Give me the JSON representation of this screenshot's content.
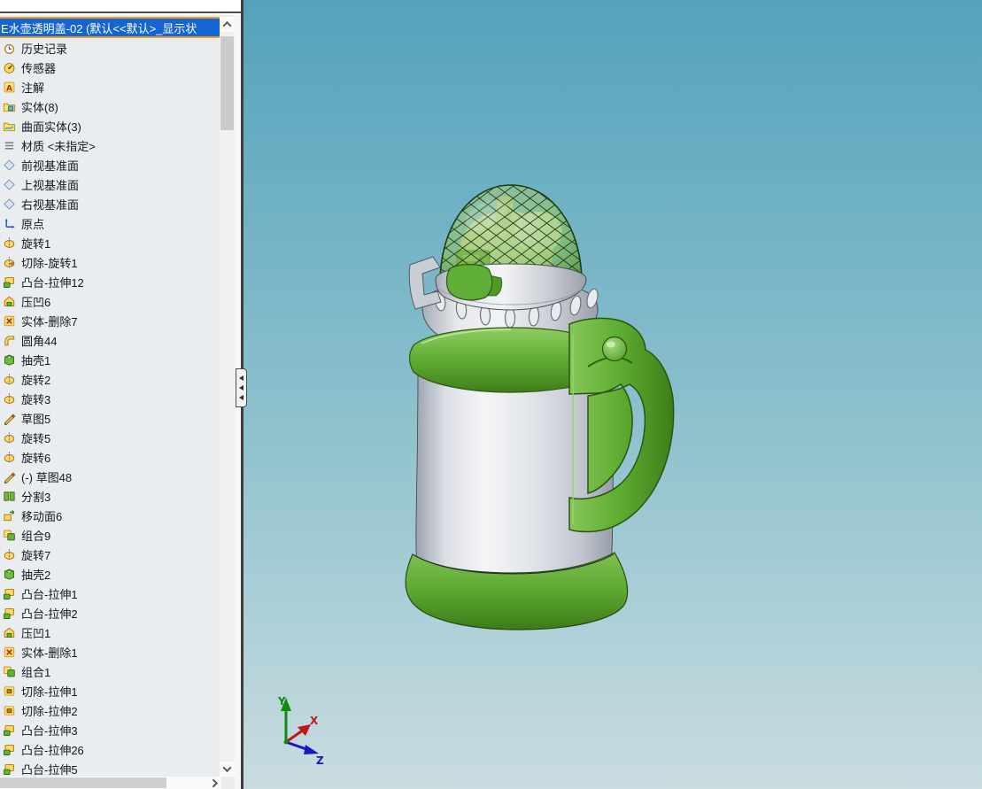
{
  "feature_tree": {
    "root": {
      "label": "E水壶透明盖-02  (默认<<默认>_显示状",
      "highlight_color": "#1464D2",
      "highlight_border": "#E8A01E"
    },
    "items": [
      {
        "label": "历史记录",
        "icon": "history"
      },
      {
        "label": "传感器",
        "icon": "sensor"
      },
      {
        "label": "注解",
        "icon": "annotation"
      },
      {
        "label": "实体(8)",
        "icon": "solid-folder"
      },
      {
        "label": "曲面实体(3)",
        "icon": "surface-folder"
      },
      {
        "label": "材质 <未指定>",
        "icon": "material"
      },
      {
        "label": "前视基准面",
        "icon": "plane"
      },
      {
        "label": "上视基准面",
        "icon": "plane"
      },
      {
        "label": "右视基准面",
        "icon": "plane"
      },
      {
        "label": "原点",
        "icon": "origin"
      },
      {
        "label": "旋转1",
        "icon": "revolve"
      },
      {
        "label": "切除-旋转1",
        "icon": "cut-revolve"
      },
      {
        "label": "凸台-拉伸12",
        "icon": "boss-extrude"
      },
      {
        "label": "压凹6",
        "icon": "indent"
      },
      {
        "label": "实体-删除7",
        "icon": "body-delete"
      },
      {
        "label": "圆角44",
        "icon": "fillet"
      },
      {
        "label": "抽壳1",
        "icon": "shell"
      },
      {
        "label": "旋转2",
        "icon": "revolve"
      },
      {
        "label": "旋转3",
        "icon": "revolve"
      },
      {
        "label": "草图5",
        "icon": "sketch"
      },
      {
        "label": "旋转5",
        "icon": "revolve"
      },
      {
        "label": "旋转6",
        "icon": "revolve"
      },
      {
        "label": "(-) 草图48",
        "icon": "sketch"
      },
      {
        "label": "分割3",
        "icon": "split"
      },
      {
        "label": "移动面6",
        "icon": "move-face"
      },
      {
        "label": "组合9",
        "icon": "combine"
      },
      {
        "label": "旋转7",
        "icon": "revolve"
      },
      {
        "label": "抽壳2",
        "icon": "shell"
      },
      {
        "label": "凸台-拉伸1",
        "icon": "boss-extrude"
      },
      {
        "label": "凸台-拉伸2",
        "icon": "boss-extrude"
      },
      {
        "label": "压凹1",
        "icon": "indent"
      },
      {
        "label": "实体-删除1",
        "icon": "body-delete"
      },
      {
        "label": "组合1",
        "icon": "combine"
      },
      {
        "label": "切除-拉伸1",
        "icon": "cut-extrude"
      },
      {
        "label": "切除-拉伸2",
        "icon": "cut-extrude"
      },
      {
        "label": "凸台-拉伸3",
        "icon": "boss-extrude"
      },
      {
        "label": "凸台-拉伸26",
        "icon": "boss-extrude"
      },
      {
        "label": "凸台-拉伸5",
        "icon": "boss-extrude"
      }
    ]
  },
  "viewport": {
    "background_top": "#54A2BC",
    "background_bottom": "#C9DCE0",
    "model": {
      "name": "water-bottle-with-transparent-lid",
      "parts": [
        "transparent-dome-lid",
        "lid-latch",
        "gray-collar",
        "collar-slots",
        "carry-clip",
        "green-shoulder-band",
        "silver-body",
        "green-handle",
        "handle-pivot-knob",
        "green-base"
      ],
      "green_color": "#5FAE36",
      "silver_color": "#E0E3E8",
      "dome_color": "#8BC05C"
    },
    "triad": {
      "x_label": "X",
      "y_label": "Y",
      "z_label": "Z",
      "x_color": "#C01818",
      "y_color": "#0B8F0B",
      "z_color": "#1818C0"
    }
  }
}
